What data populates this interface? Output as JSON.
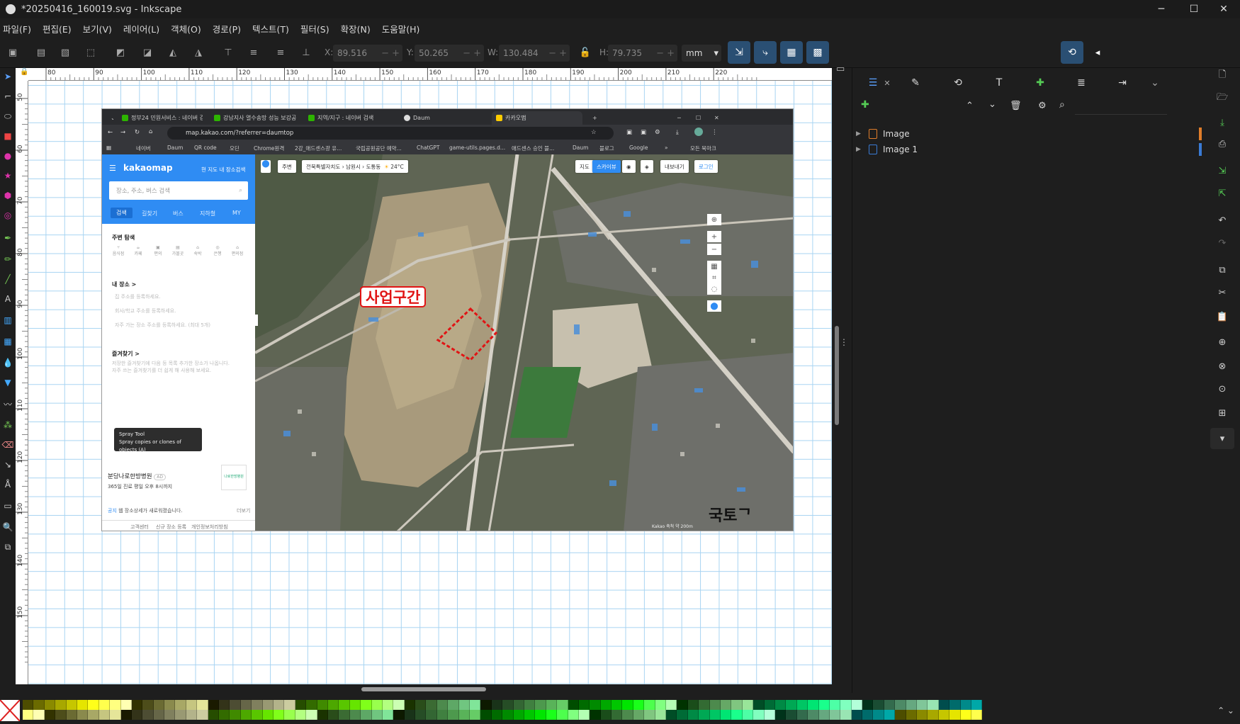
{
  "window": {
    "title": "*20250416_160019.svg - Inkscape"
  },
  "menu": [
    "파일(F)",
    "편집(E)",
    "보기(V)",
    "레이어(L)",
    "객체(O)",
    "경로(P)",
    "텍스트(T)",
    "필터(S)",
    "확장(N)",
    "도움말(H)"
  ],
  "toolbar": {
    "x_label": "X:",
    "x_value": "89.516",
    "y_label": "Y:",
    "y_value": "50.265",
    "w_label": "W:",
    "w_value": "130.484",
    "h_label": "H:",
    "h_value": "79.735",
    "unit": "mm"
  },
  "ruler": {
    "h": [
      "80",
      "90",
      "100",
      "110",
      "120",
      "130",
      "140",
      "150",
      "160",
      "170",
      "180",
      "190",
      "200",
      "210",
      "220"
    ],
    "v": [
      "50",
      "60",
      "70",
      "80",
      "90",
      "100",
      "110",
      "120",
      "130",
      "140",
      "150"
    ]
  },
  "browser": {
    "tabs": [
      "정부24 민원서비스 : 네이버 검",
      "강남지사 열수송망 성능 보강공",
      "지역/지구 : 네이버 검색",
      "Daum",
      "카카오맵"
    ],
    "url": "map.kakao.com/?referrer=daumtop",
    "bookmarks": [
      "네이버",
      "Daum",
      "QR code",
      "오딘",
      "Chrome원격",
      "2강_애드센스광 유...",
      "국립공원공단 예약...",
      "ChatGPT",
      "game-utils.pages.d...",
      "애드센스 승인 블...",
      "Daum",
      "블로그",
      "Google",
      "»",
      "모든 북마크"
    ]
  },
  "kakaomap": {
    "logo": "kakaomap",
    "toggle": "현 지도 내 장소검색",
    "search_placeholder": "장소, 주소, 버스 검색",
    "tabs": [
      "검색",
      "길찾기",
      "버스",
      "지하철",
      "MY"
    ],
    "nearby_title": "주변 탐색",
    "nearby_items": [
      "음식점",
      "카페",
      "편의",
      "가볼곳",
      "숙박",
      "은행",
      "편의점"
    ],
    "my_places_title": "내 장소 >",
    "my_places": [
      "집 주소를 등록하세요.",
      "회사/학교 주소를 등록하세요.",
      "자주 가는 장소 주소를 등록하세요. (최대 5개)"
    ],
    "favorites_title": "즐겨찾기 >",
    "favorites_desc": [
      "저장한 즐겨찾기에 다음 등 목록 추가한 장소가 나옵니다.",
      "자주 쓰는 즐겨찾기를 더 쉽게 해 사용해 보세요."
    ],
    "tooltip_title": "Spray Tool",
    "tooltip_desc": "Spray copies or clones of objects (A)",
    "ad_name": "분당나로한방병원",
    "ad_badge": "AD",
    "ad_desc": "365일 진료 평일 오후 8시까지",
    "ad_logo": "나로한방병원",
    "notice_tag": "공지",
    "notice": "웹 장소상세가 새로워졌습니다.",
    "notice_more": "더보기",
    "footer": [
      "고객센터",
      "신규 장소 등록",
      "개인정보처리방침"
    ]
  },
  "map": {
    "nearby_btn": "주변",
    "breadcrumb": [
      "전북특별자치도",
      "남원시",
      "도통동"
    ],
    "weather": "24°C",
    "mode": [
      "지도",
      "스카이뷰"
    ],
    "export_btn": "내보내기",
    "login_btn": "로그인",
    "scale": "Kakao 축척 약 200m",
    "project_label": "사업구간"
  },
  "canvas": {
    "stray_text": "국토ᄀ"
  },
  "layers": {
    "items": [
      "Image",
      "Image 1"
    ],
    "colors": [
      "#e07d2a",
      "#3a7bd5"
    ]
  },
  "palette": {
    "colors": [
      "#4d4d00",
      "#6b6b00",
      "#8a8a00",
      "#a8a800",
      "#c6c600",
      "#e5e500",
      "#ffff1a",
      "#ffff4d",
      "#ffff80",
      "#ffffb3",
      "#333300",
      "#4d4d1a",
      "#6b6b33",
      "#8a8a4d",
      "#a8a866",
      "#c6c680",
      "#e5e599",
      "#1a1a00",
      "#333319",
      "#4d4d33",
      "#666648",
      "#80805e",
      "#999973",
      "#b3b38a",
      "#cccca0",
      "#264d00",
      "#336b00",
      "#408a00",
      "#4da800",
      "#59c600",
      "#66e500",
      "#80ff1a",
      "#99ff4d",
      "#b3ff80",
      "#ccffb3",
      "#1a3300",
      "#2a4d1a",
      "#3b6b33",
      "#4d8a4d",
      "#5ea866",
      "#70c680",
      "#80e599",
      "#0d1a00",
      "#193319",
      "#264d26",
      "#336633",
      "#408040",
      "#4d994d",
      "#59b359",
      "#66cc66",
      "#004d00",
      "#006b00",
      "#008a00",
      "#00a800",
      "#00c600",
      "#00e500",
      "#1aff1a",
      "#4dff4d",
      "#80ff80",
      "#b3ffb3",
      "#003300",
      "#1a4d1a",
      "#336b33",
      "#4d8a4d",
      "#66a866",
      "#80c680",
      "#99e599",
      "#004d26",
      "#006b36",
      "#008a45",
      "#00a854",
      "#00c664",
      "#00e573",
      "#1aff8c",
      "#4dffa6",
      "#80ffbf",
      "#b3ffd9",
      "#00331a",
      "#1a4d33",
      "#336b4d",
      "#4d8a66",
      "#66a880",
      "#80c699",
      "#99e5b3",
      "#004d4d",
      "#006b6b",
      "#008a8a",
      "#00a8a8"
    ]
  }
}
